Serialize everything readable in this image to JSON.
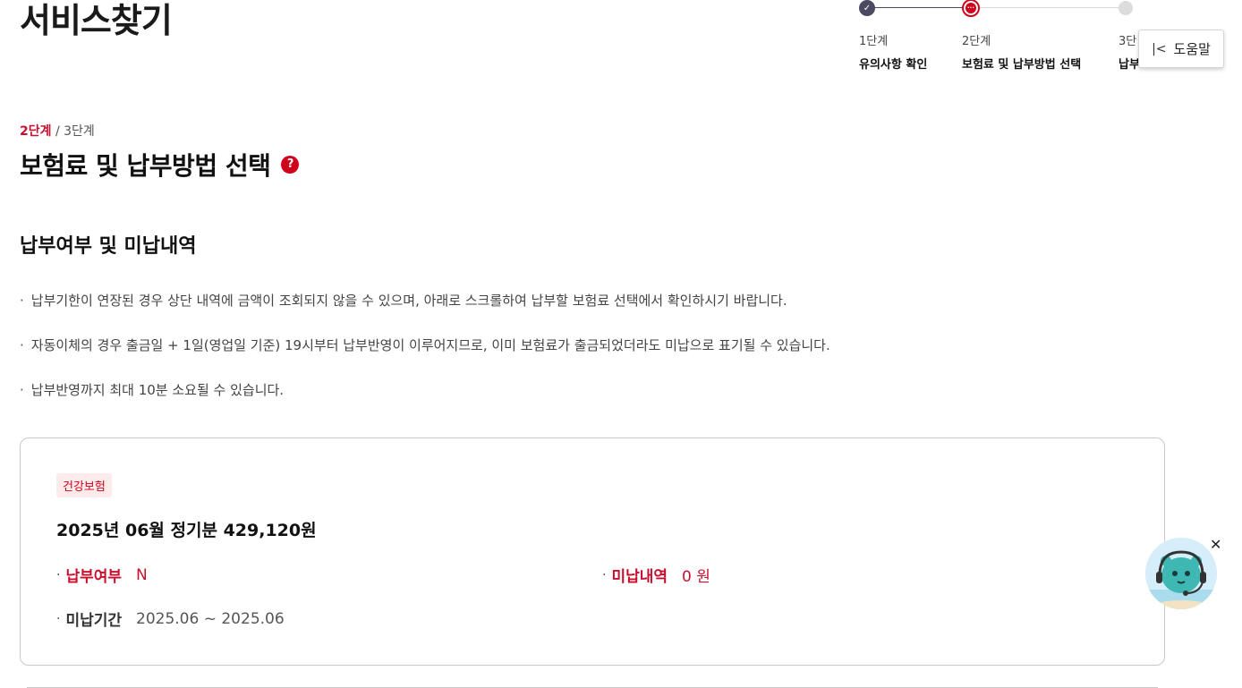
{
  "page": {
    "title": "서비스찾기"
  },
  "stepper": {
    "steps": [
      {
        "num": "1단계",
        "name": "유의사항 확인",
        "state": "done"
      },
      {
        "num": "2단계",
        "name": "보험료 및 납부방법 선택",
        "state": "current"
      },
      {
        "num": "3단",
        "name": "납부",
        "state": "todo"
      }
    ]
  },
  "help": {
    "label": "도움말"
  },
  "section": {
    "crumb_current": "2단계",
    "crumb_rest": " / 3단계",
    "title": "보험료 및 납부방법 선택",
    "help_icon": "?"
  },
  "subsection": {
    "title": "납부여부 및 미납내역",
    "notes": [
      "납부기한이 연장된 경우 상단 내역에 금액이 조회되지 않을 수 있으며, 아래로 스크롤하여 납부할 보험료 선택에서 확인하시기 바랍니다.",
      "자동이체의 경우 출금일 + 1일(영업일 기준) 19시부터 납부반영이 이루어지므로, 이미 보험료가 출금되었더라도 미납으로 표기될 수 있습니다.",
      "납부반영까지 최대 10분 소요될 수 있습니다."
    ],
    "bullet": "·"
  },
  "card": {
    "badge": "건강보험",
    "title": "2025년 06월 정기분 429,120원",
    "payment_status_label": "납부여부",
    "payment_status_value": "N",
    "unpaid_label": "미납내역",
    "unpaid_value": "0 원",
    "unpaid_period_label": "미납기간",
    "unpaid_period_value": "2025.06 ~ 2025.06",
    "bullet": "·"
  },
  "chatbot": {
    "icon": "chatbot-mascot-icon",
    "close": "✕"
  },
  "colors": {
    "accent": "#c8102e",
    "step_done": "#4a4a63",
    "badge_bg": "#fdebec"
  }
}
